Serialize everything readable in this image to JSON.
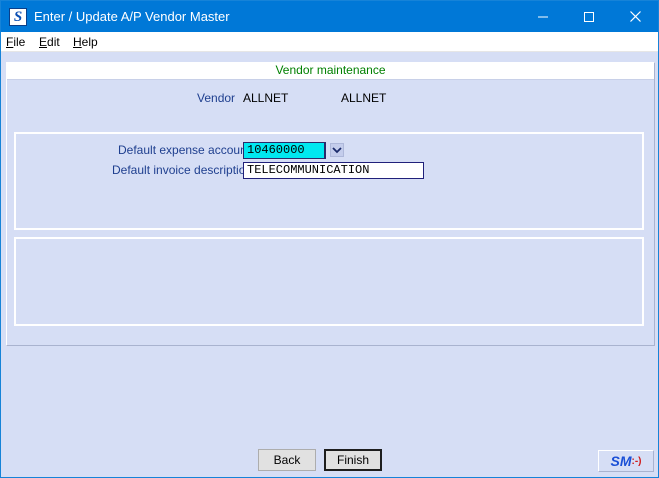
{
  "window": {
    "title": "Enter / Update A/P Vendor Master",
    "app_icon_letter": "S"
  },
  "menu": {
    "file": "File",
    "file_rest": "ile",
    "file_accel": "F",
    "edit_accel": "E",
    "edit_rest": "dit",
    "help_accel": "H",
    "help_rest": "elp"
  },
  "section": {
    "header": "Vendor maintenance"
  },
  "vendor": {
    "label": "Vendor",
    "code": "ALLNET",
    "name": "ALLNET"
  },
  "fields": {
    "expense_account_label": "Default expense account",
    "expense_account_value": "10460000",
    "invoice_desc_label": "Default invoice description",
    "invoice_desc_value": "TELECOMMUNICATION"
  },
  "buttons": {
    "back": "Back",
    "finish": "Finish"
  },
  "logo": {
    "sm": "SM",
    "smiley": ":-)"
  },
  "colors": {
    "titlebar": "#0078d7",
    "background": "#d6def5",
    "header_text": "#008000",
    "label_text": "#1f3f8f",
    "account_field": "#00e8f0"
  }
}
